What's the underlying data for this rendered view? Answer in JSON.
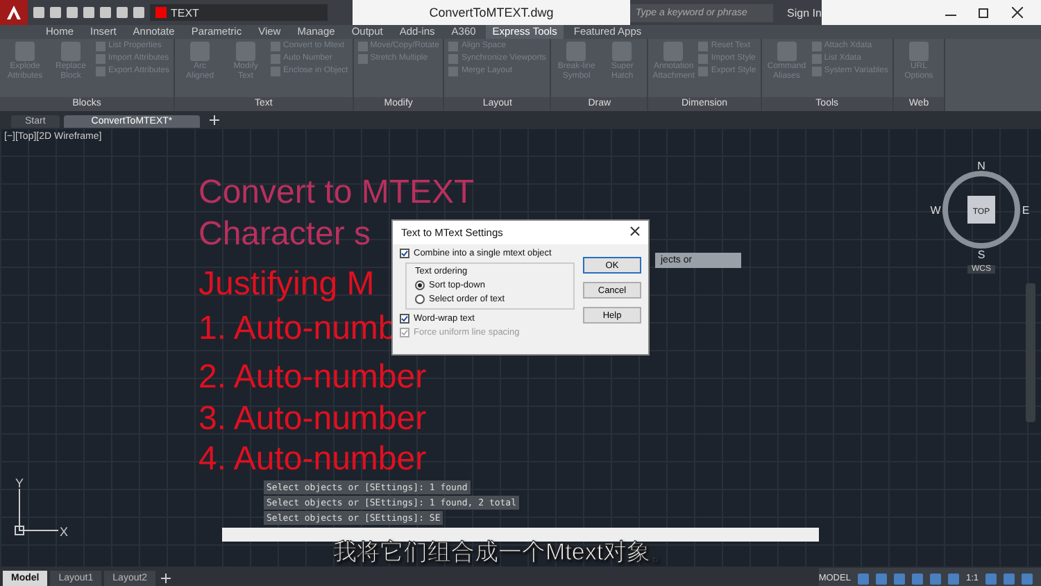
{
  "app": {
    "layer": "TEXT",
    "title": "ConvertToMTEXT.dwg",
    "search": {
      "placeholder": "Type a keyword or phrase"
    },
    "sign_in": "Sign In"
  },
  "ribbon_tabs": [
    {
      "label": "Home",
      "selected": false
    },
    {
      "label": "Insert",
      "selected": false
    },
    {
      "label": "Annotate",
      "selected": false
    },
    {
      "label": "Parametric",
      "selected": false
    },
    {
      "label": "View",
      "selected": false
    },
    {
      "label": "Manage",
      "selected": false
    },
    {
      "label": "Output",
      "selected": false
    },
    {
      "label": "Add-ins",
      "selected": false
    },
    {
      "label": "A360",
      "selected": false
    },
    {
      "label": "Express Tools",
      "selected": true
    },
    {
      "label": "Featured Apps",
      "selected": false
    }
  ],
  "panels": [
    {
      "title": "Blocks",
      "buttons": [
        {
          "kind": "large",
          "label": "Explode Attributes"
        },
        {
          "kind": "large",
          "label": "Replace Block"
        },
        {
          "kind": "small",
          "label": "List Properties"
        },
        {
          "kind": "small",
          "label": "Import Attributes"
        },
        {
          "kind": "small",
          "label": "Export Attributes"
        }
      ]
    },
    {
      "title": "Text",
      "buttons": [
        {
          "kind": "large",
          "label": "Arc Aligned"
        },
        {
          "kind": "large",
          "label": "Modify Text"
        },
        {
          "kind": "small",
          "label": "Convert to Mtext"
        },
        {
          "kind": "small",
          "label": "Auto Number"
        },
        {
          "kind": "small",
          "label": "Enclose in Object"
        }
      ]
    },
    {
      "title": "Modify",
      "buttons": [
        {
          "kind": "small",
          "label": "Move/Copy/Rotate"
        },
        {
          "kind": "small",
          "label": "Stretch Multiple"
        }
      ]
    },
    {
      "title": "Layout",
      "buttons": [
        {
          "kind": "small",
          "label": "Align Space"
        },
        {
          "kind": "small",
          "label": "Synchronize Viewports"
        },
        {
          "kind": "small",
          "label": "Merge Layout"
        }
      ]
    },
    {
      "title": "Draw",
      "buttons": [
        {
          "kind": "large",
          "label": "Break-line Symbol"
        },
        {
          "kind": "large",
          "label": "Super Hatch"
        }
      ]
    },
    {
      "title": "Dimension",
      "buttons": [
        {
          "kind": "large",
          "label": "Annotation Attachment"
        },
        {
          "kind": "small",
          "label": "Reset Text"
        },
        {
          "kind": "small",
          "label": "Import Style"
        },
        {
          "kind": "small",
          "label": "Export Style"
        }
      ]
    },
    {
      "title": "Tools",
      "buttons": [
        {
          "kind": "large",
          "label": "Command Aliases"
        },
        {
          "kind": "small",
          "label": "Attach Xdata"
        },
        {
          "kind": "small",
          "label": "List Xdata"
        },
        {
          "kind": "small",
          "label": "System Variables"
        }
      ]
    },
    {
      "title": "Web",
      "buttons": [
        {
          "kind": "large",
          "label": "URL Options"
        }
      ]
    }
  ],
  "file_tabs": [
    {
      "label": "Start",
      "selected": false
    },
    {
      "label": "ConvertToMTEXT*",
      "selected": true
    }
  ],
  "viewport": {
    "label": "[−][Top][2D Wireframe]",
    "drawing_texts": [
      {
        "text": "Convert to MTEXT",
        "color": "#b8305e"
      },
      {
        "text": "Character s",
        "color": "#b8305e"
      },
      {
        "text": "Justifying M",
        "color": "#e01020"
      },
      {
        "text": "1. Auto-numb",
        "color": "#e01020"
      },
      {
        "text": "2. Auto-number",
        "color": "#e01020"
      },
      {
        "text": "3. Auto-number",
        "color": "#e01020"
      },
      {
        "text": "4. Auto-number",
        "color": "#e01020"
      }
    ],
    "tooltip": "jects or",
    "viewcube": {
      "north": "N",
      "south": "S",
      "west": "W",
      "east": "E",
      "face": "TOP",
      "ucs": "WCS"
    },
    "ucs_icon": {
      "y": "Y",
      "x": "X"
    },
    "command_history": [
      "Select objects or [SEttings]: 1 found",
      "Select objects or [SEttings]: 1 found, 2 total",
      "Select objects or [SEttings]: SE"
    ]
  },
  "dialog": {
    "title": "Text to MText Settings",
    "combine": {
      "label": "Combine into a single mtext object",
      "checked": true
    },
    "group": "Text ordering",
    "orderings": [
      {
        "label": "Sort top-down",
        "selected": true
      },
      {
        "label": "Select order of text",
        "selected": false
      }
    ],
    "word_wrap": {
      "label": "Word-wrap text",
      "checked": true
    },
    "uniform": {
      "label": "Force uniform line spacing",
      "checked": true,
      "disabled": true
    },
    "buttons": [
      "OK",
      "Cancel",
      "Help"
    ]
  },
  "subtitle": "我将它们组合成一个Mtext对象。",
  "layout_tabs": [
    {
      "label": "Model",
      "selected": true
    },
    {
      "label": "Layout1",
      "selected": false
    },
    {
      "label": "Layout2",
      "selected": false
    }
  ],
  "status_bar": {
    "mode": "MODEL",
    "scale": "1:1"
  }
}
